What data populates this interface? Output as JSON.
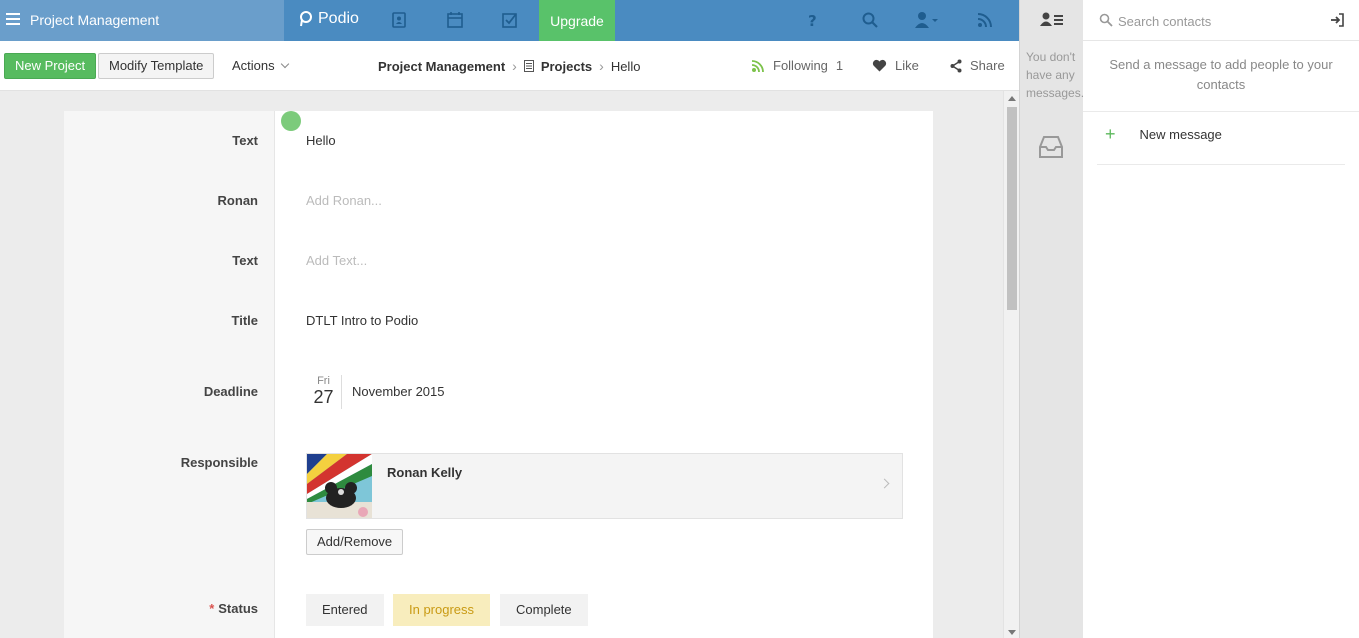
{
  "topbar": {
    "workspace_title": "Project Management",
    "logo_text": "Podio",
    "upgrade_label": "Upgrade",
    "icons": [
      "contacts-book-icon",
      "calendar-icon",
      "tasks-check-icon",
      "help-icon",
      "search-icon",
      "user-menu-icon",
      "activity-feed-icon"
    ],
    "colors": {
      "bar": "#4a8bc1",
      "brand_zone": "#6a9ecb",
      "upgrade": "#59c26a"
    }
  },
  "toolbar": {
    "new_label": "New Project",
    "modify_label": "Modify Template",
    "actions_label": "Actions",
    "breadcrumb": {
      "workspace": "Project Management",
      "app": "Projects",
      "item": "Hello"
    },
    "following_label": "Following",
    "following_count": "1",
    "like_label": "Like",
    "share_label": "Share"
  },
  "fields": {
    "text1": {
      "label": "Text",
      "value": "Hello"
    },
    "ronan": {
      "label": "Ronan",
      "placeholder": "Add Ronan..."
    },
    "text2": {
      "label": "Text",
      "placeholder": "Add Text..."
    },
    "title": {
      "label": "Title",
      "value": "DTLT Intro to Podio"
    },
    "deadline": {
      "label": "Deadline",
      "dow": "Fri",
      "day": "27",
      "month_year": "November 2015"
    },
    "responsible": {
      "label": "Responsible",
      "name": "Ronan Kelly",
      "add_label": "Add/Remove"
    },
    "status": {
      "label": "Status",
      "required_mark": "*",
      "options": [
        "Entered",
        "In progress",
        "Complete"
      ],
      "selected": "In progress"
    }
  },
  "side": {
    "no_messages": "You don't have any messages."
  },
  "contacts": {
    "search_placeholder": "Search contacts",
    "hint": "Send a message to add people to your contacts",
    "new_message_label": "New message"
  }
}
